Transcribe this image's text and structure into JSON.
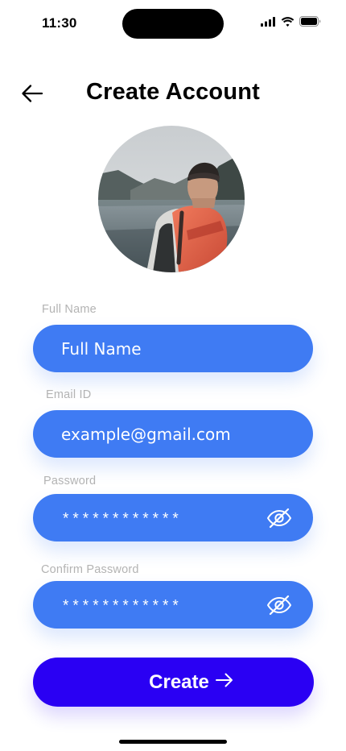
{
  "status_bar": {
    "time": "11:30",
    "icons": [
      "cellular-signal-icon",
      "wifi-icon",
      "battery-icon"
    ]
  },
  "header": {
    "title": "Create Account",
    "back_icon": "arrow-left-icon"
  },
  "avatar": {
    "icon": "profile-photo"
  },
  "form": {
    "full_name": {
      "label": "Full Name",
      "value": "Full Name"
    },
    "email": {
      "label": "Email ID",
      "value": "example@gmail.com"
    },
    "password": {
      "label": "Password",
      "value": "************",
      "toggle_icon": "eye-off-icon"
    },
    "confirm_password": {
      "label": "Confirm Password",
      "value": "************",
      "toggle_icon": "eye-off-icon"
    }
  },
  "create_button": {
    "label": "Create",
    "icon": "arrow-right-icon"
  },
  "colors": {
    "field_background": "#3f7bf3",
    "button_background": "#2a00f3",
    "label_color": "#b3b3b3",
    "text_on_field": "#ffffff"
  }
}
